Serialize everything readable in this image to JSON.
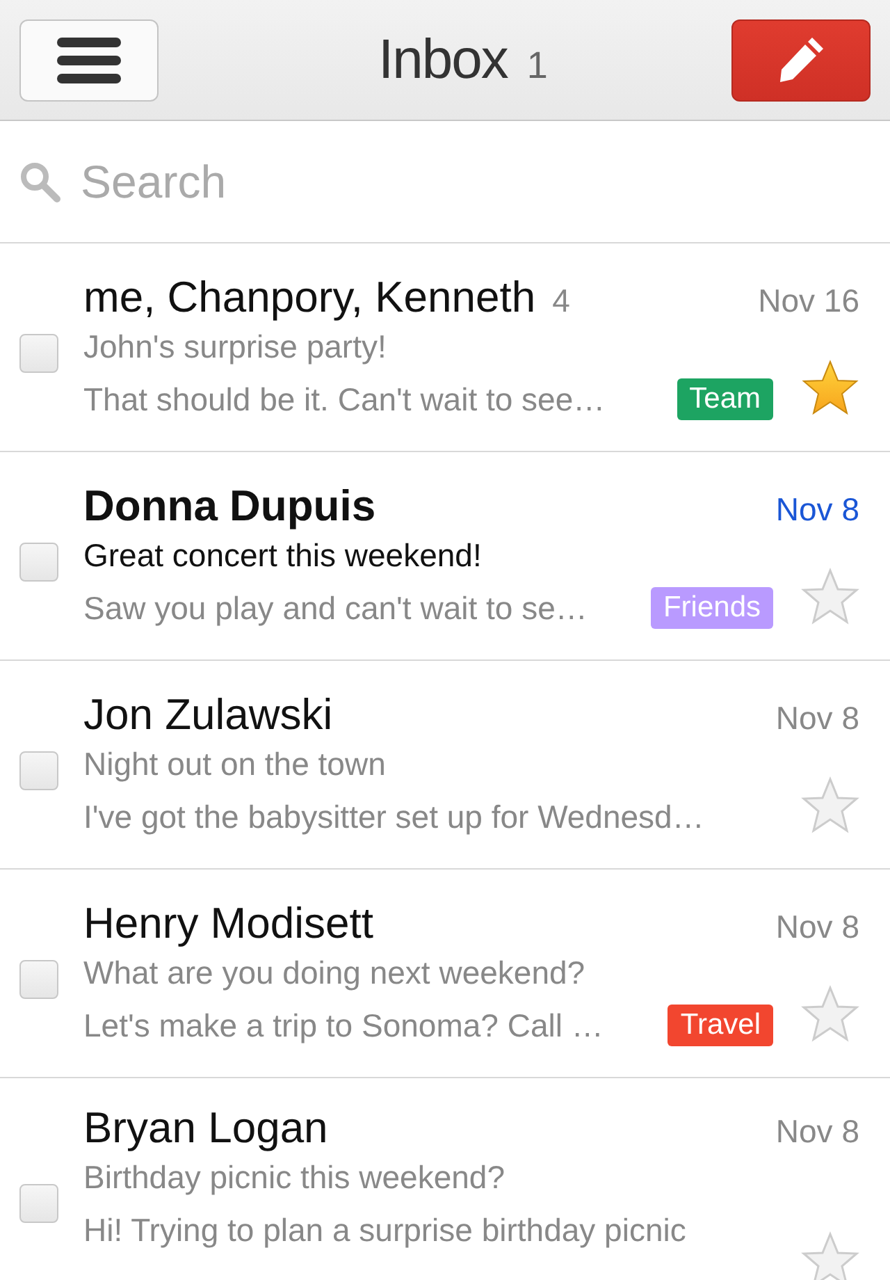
{
  "header": {
    "title": "Inbox",
    "count": "1"
  },
  "search": {
    "placeholder": "Search"
  },
  "messages": [
    {
      "sender": "me, Chanpory, Kenneth",
      "thread_count": "4",
      "date": "Nov 16",
      "subject": "John's surprise party!",
      "snippet": "That should be it. Can't wait to see…",
      "label": {
        "text": "Team",
        "color": "#1da462"
      },
      "unread": false,
      "starred": true,
      "checked": false
    },
    {
      "sender": "Donna Dupuis",
      "date": "Nov 8",
      "subject": "Great concert this weekend!",
      "snippet": "Saw you play and can't wait to se…",
      "label": {
        "text": "Friends",
        "color": "#b99aff"
      },
      "unread": true,
      "starred": false,
      "checked": false
    },
    {
      "sender": "Jon Zulawski",
      "date": "Nov 8",
      "subject": "Night out on the town",
      "snippet": "I've got the babysitter set up for Wednesd…",
      "unread": false,
      "starred": false,
      "checked": false
    },
    {
      "sender": "Henry Modisett",
      "date": "Nov 8",
      "subject": "What are you doing next weekend?",
      "snippet": "Let's make a trip to Sonoma? Call …",
      "label": {
        "text": "Travel",
        "color": "#f2462f"
      },
      "unread": false,
      "starred": false,
      "checked": false
    },
    {
      "sender": "Bryan Logan",
      "date": "Nov 8",
      "subject": "Birthday picnic this weekend?",
      "snippet": "Hi! Trying to plan a surprise birthday picnic",
      "unread": false,
      "starred": false,
      "checked": false
    }
  ]
}
